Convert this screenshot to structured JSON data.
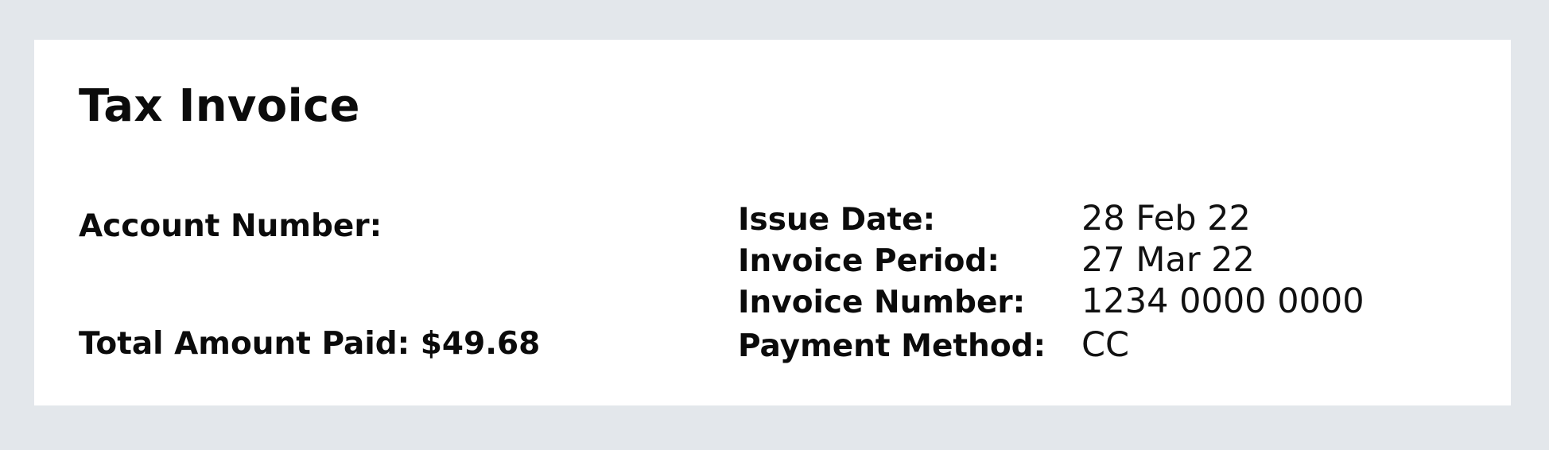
{
  "invoice": {
    "title": "Tax Invoice",
    "account_number_label": "Account Number:",
    "total_amount_paid_label": "Total Amount Paid: $49.68",
    "details": [
      {
        "label": "Issue Date:",
        "value": "28 Feb 22"
      },
      {
        "label": "Invoice Period:",
        "value": "27 Mar 22"
      },
      {
        "label": "Invoice Number:",
        "value": "1234 0000 0000"
      },
      {
        "label": "Payment Method:",
        "value": "CC"
      }
    ]
  }
}
